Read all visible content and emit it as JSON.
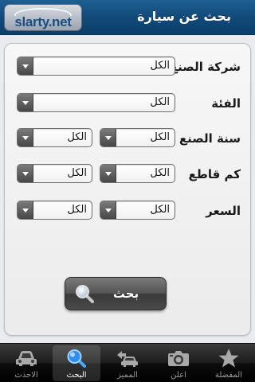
{
  "header": {
    "logo_text": "slarty.net",
    "title": "بحث عن سيارة"
  },
  "form": {
    "rows": [
      {
        "label": "شركة الصنع",
        "values": [
          "الكل"
        ]
      },
      {
        "label": "الفئة",
        "values": [
          "الكل"
        ]
      },
      {
        "label": "سنة الصنع",
        "values": [
          "الكل",
          "الكل"
        ]
      },
      {
        "label": "كم قاطع",
        "values": [
          "الكل",
          "الكل"
        ]
      },
      {
        "label": "السعر",
        "values": [
          "الكل",
          "الكل"
        ]
      }
    ],
    "search_button": "بحث"
  },
  "tabbar": {
    "tabs": [
      {
        "label": "الاحدث",
        "icon": "car-icon"
      },
      {
        "label": "البحث",
        "icon": "search-icon",
        "active": true
      },
      {
        "label": "المميز",
        "icon": "featured-car-icon"
      },
      {
        "label": "اعلن",
        "icon": "camera-icon"
      },
      {
        "label": "المفضلة",
        "icon": "star-icon"
      }
    ]
  },
  "colors": {
    "header": "#114a7a",
    "panel": "#f2f2f2",
    "tabbar": "#1c1c1c"
  }
}
